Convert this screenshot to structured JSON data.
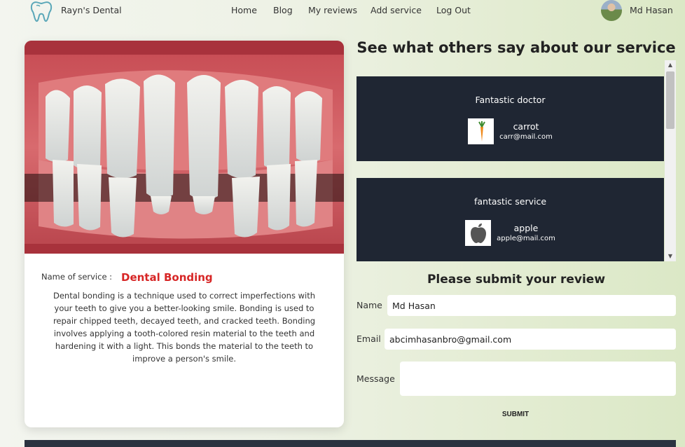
{
  "nav": {
    "brand": "Rayn's Dental",
    "items": [
      "Home",
      "Blog",
      "My reviews",
      "Add service",
      "Log Out"
    ],
    "user_name": "Md Hasan"
  },
  "service": {
    "label": "Name of service :",
    "name": "Dental Bonding",
    "description": "Dental bonding is a technique used to correct imperfections with your teeth to give you a better-looking smile. Bonding is used to repair chipped teeth, decayed teeth, and cracked teeth. Bonding involves applying a tooth-colored resin material to the teeth and hardening it with a light. This bonds the material to the teeth to improve a person's smile."
  },
  "reviews": {
    "title": "See what others say about our service",
    "items": [
      {
        "text": "Fantastic doctor",
        "name": "carrot",
        "email": "carr@mail.com",
        "icon": "carrot-icon"
      },
      {
        "text": "fantastic service",
        "name": "apple",
        "email": "apple@mail.com",
        "icon": "apple-icon"
      }
    ]
  },
  "form": {
    "title": "Please submit your review",
    "name_label": "Name",
    "name_value": "Md Hasan",
    "email_label": "Email",
    "email_value": "abcimhasanbro@gmail.com",
    "message_label": "Message",
    "message_value": "",
    "submit_label": "SUBMIT"
  },
  "colors": {
    "accent_red": "#d72626",
    "review_card_bg": "#1f2633",
    "footer_bg": "#2b3340"
  }
}
